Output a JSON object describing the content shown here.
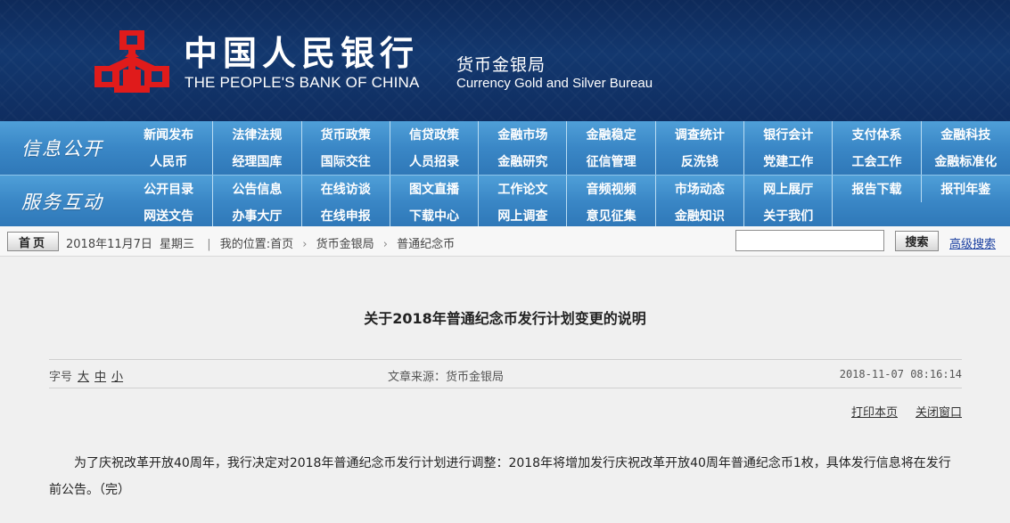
{
  "header": {
    "bank_name_cn": "中国人民银行",
    "bank_name_en": "THE PEOPLE'S BANK OF CHINA",
    "bureau_cn": "货币金银局",
    "bureau_en": "Currency  Gold and Silver Bureau",
    "logo_color": "#e01b1b"
  },
  "nav": {
    "section1_label": "信息公开",
    "section2_label": "服务互动",
    "row1": [
      "新闻发布",
      "法律法规",
      "货币政策",
      "信贷政策",
      "金融市场",
      "金融稳定",
      "调查统计",
      "银行会计",
      "支付体系",
      "金融科技"
    ],
    "row2": [
      "人民币",
      "经理国库",
      "国际交往",
      "人员招录",
      "金融研究",
      "征信管理",
      "反洗钱",
      "党建工作",
      "工会工作",
      "金融标准化"
    ],
    "row3": [
      "公开目录",
      "公告信息",
      "在线访谈",
      "图文直播",
      "工作论文",
      "音频视频",
      "市场动态",
      "网上展厅",
      "报告下载",
      "报刊年鉴"
    ],
    "row4": [
      "网送文告",
      "办事大厅",
      "在线申报",
      "下载中心",
      "网上调查",
      "意见征集",
      "金融知识",
      "关于我们"
    ],
    "bg_color": "#3a87c6"
  },
  "crumb": {
    "home_label": "首页",
    "date": "2018年11月7日",
    "weekday": "星期三",
    "location_label": "我的位置:",
    "path": [
      "首页",
      "货币金银局",
      "普通纪念币"
    ],
    "search_placeholder": "",
    "search_button": "搜索",
    "advanced_search": "高级搜索"
  },
  "article": {
    "title": "关于2018年普通纪念币发行计划变更的说明",
    "font_size_label": "字号",
    "font_large": "大",
    "font_medium": "中",
    "font_small": "小",
    "source": "文章来源：货币金银局",
    "datetime": "2018-11-07 08:16:14",
    "print_link": "打印本页",
    "close_link": "关闭窗口",
    "body": "为了庆祝改革开放40周年，我行决定对2018年普通纪念币发行计划进行调整：2018年将增加发行庆祝改革开放40周年普通纪念币1枚，具体发行信息将在发行前公告。（完）"
  }
}
